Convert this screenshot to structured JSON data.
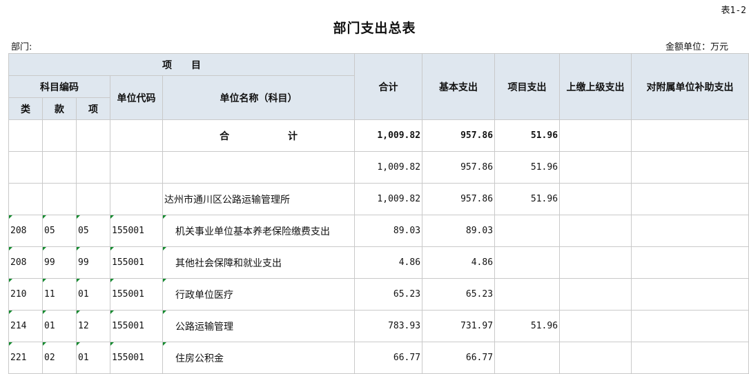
{
  "table_no": "表1-2",
  "title": "部门支出总表",
  "dept_label": "部门:",
  "unit_label": "金额单位：万元",
  "headers": {
    "project": "项　　目",
    "subject_code": "科目编码",
    "unit_code": "单位代码",
    "unit_name": "单位名称（科目）",
    "lei": "类",
    "kuan": "款",
    "xiang": "项",
    "total": "合计",
    "basic": "基本支出",
    "project_exp": "项目支出",
    "superior": "上缴上级支出",
    "subsidy": "对附属单位补助支出"
  },
  "rows": [
    {
      "lei": "",
      "kuan": "",
      "xiang": "",
      "unit_code": "",
      "name": "合 计",
      "total": "1,009.82",
      "basic": "957.86",
      "project": "51.96",
      "superior": "",
      "subsidy": ""
    },
    {
      "lei": "",
      "kuan": "",
      "xiang": "",
      "unit_code": "",
      "name": "",
      "total": "1,009.82",
      "basic": "957.86",
      "project": "51.96",
      "superior": "",
      "subsidy": ""
    },
    {
      "lei": "",
      "kuan": "",
      "xiang": "",
      "unit_code": "",
      "name": "达州市通川区公路运输管理所",
      "total": "1,009.82",
      "basic": "957.86",
      "project": "51.96",
      "superior": "",
      "subsidy": ""
    },
    {
      "lei": "208",
      "kuan": "05",
      "xiang": "05",
      "unit_code": "155001",
      "name": "机关事业单位基本养老保险缴费支出",
      "total": "89.03",
      "basic": "89.03",
      "project": "",
      "superior": "",
      "subsidy": ""
    },
    {
      "lei": "208",
      "kuan": "99",
      "xiang": "99",
      "unit_code": "155001",
      "name": "其他社会保障和就业支出",
      "total": "4.86",
      "basic": "4.86",
      "project": "",
      "superior": "",
      "subsidy": ""
    },
    {
      "lei": "210",
      "kuan": "11",
      "xiang": "01",
      "unit_code": "155001",
      "name": "行政单位医疗",
      "total": "65.23",
      "basic": "65.23",
      "project": "",
      "superior": "",
      "subsidy": ""
    },
    {
      "lei": "214",
      "kuan": "01",
      "xiang": "12",
      "unit_code": "155001",
      "name": "公路运输管理",
      "total": "783.93",
      "basic": "731.97",
      "project": "51.96",
      "superior": "",
      "subsidy": ""
    },
    {
      "lei": "221",
      "kuan": "02",
      "xiang": "01",
      "unit_code": "155001",
      "name": "住房公积金",
      "total": "66.77",
      "basic": "66.77",
      "project": "",
      "superior": "",
      "subsidy": ""
    }
  ]
}
